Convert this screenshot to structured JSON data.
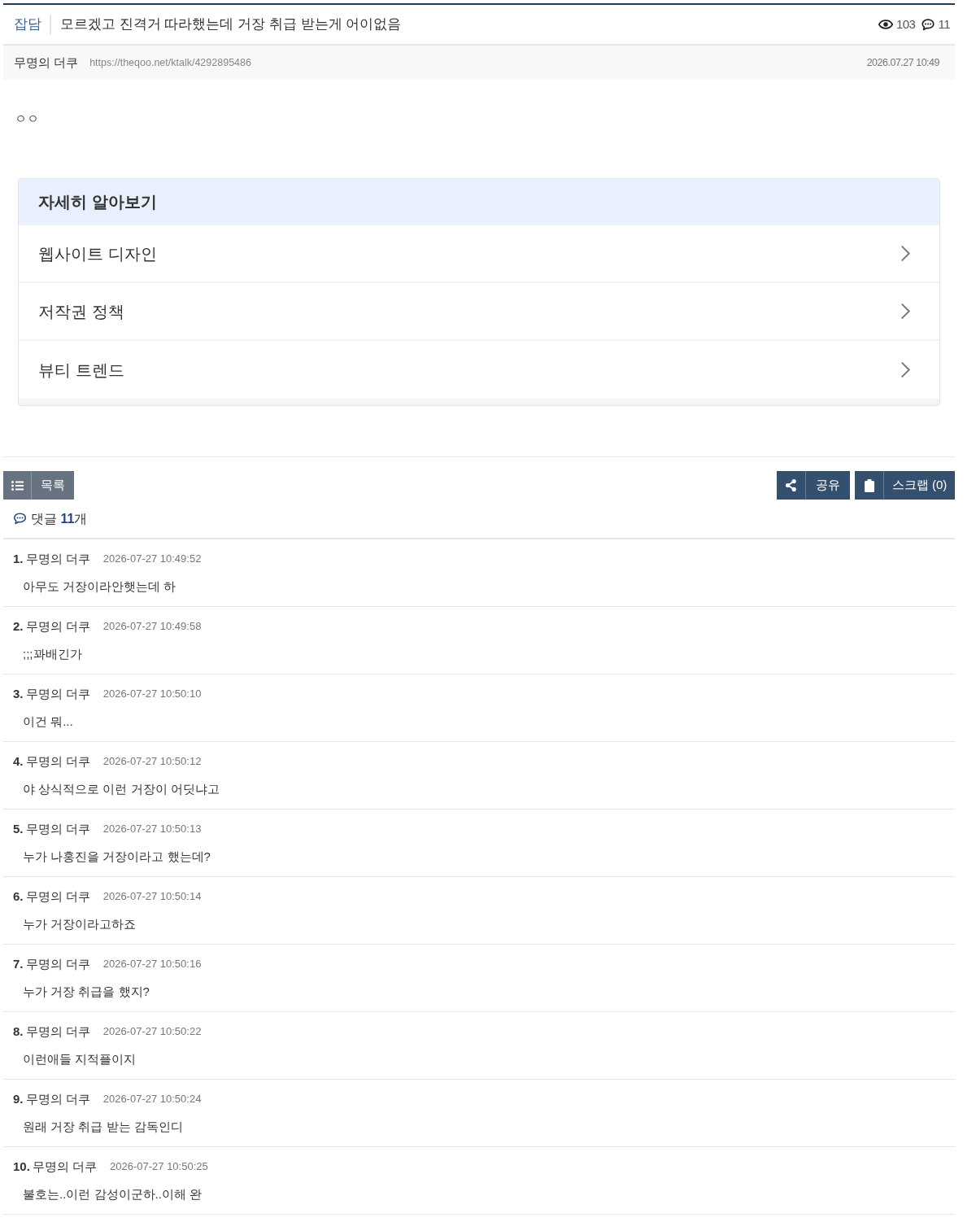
{
  "post": {
    "category": "잡담",
    "title": "모르겠고 진격거 따라했는데 거장 취급 받는게 어이없음",
    "views": "103",
    "comment_count": "11",
    "author": "무명의 더쿠",
    "url": "https://theqoo.net/ktalk/4292895486",
    "date": "2026.07.27 10:49",
    "body": "ㅇㅇ"
  },
  "related": {
    "title": "자세히 알아보기",
    "items": [
      {
        "label": "웹사이트 디자인"
      },
      {
        "label": "저작권 정책"
      },
      {
        "label": "뷰티 트렌드"
      }
    ]
  },
  "actions": {
    "list": "목록",
    "share": "공유",
    "scrap": "스크랩 (0)"
  },
  "comments_heading": "댓글 **11**개",
  "comments": [
    {
      "number": "1.",
      "author": "무명의 더쿠",
      "time": "2026-07-27 10:49:52",
      "text": "아무도 거장이라안햇는데 하"
    },
    {
      "number": "2.",
      "author": "무명의 더쿠",
      "time": "2026-07-27 10:49:58",
      "text": ";;;꽈배긴가"
    },
    {
      "number": "3.",
      "author": "무명의 더쿠",
      "time": "2026-07-27 10:50:10",
      "text": "이건 뭐..."
    },
    {
      "number": "4.",
      "author": "무명의 더쿠",
      "time": "2026-07-27 10:50:12",
      "text": "야 상식적으로 이런 거장이 어딧냐고"
    },
    {
      "number": "5.",
      "author": "무명의 더쿠",
      "time": "2026-07-27 10:50:13",
      "text": "누가 나홍진을 거장이라고 했는데?"
    },
    {
      "number": "6.",
      "author": "무명의 더쿠",
      "time": "2026-07-27 10:50:14",
      "text": "누가 거장이라고하죠"
    },
    {
      "number": "7.",
      "author": "무명의 더쿠",
      "time": "2026-07-27 10:50:16",
      "text": "누가 거장 취급을 했지?"
    },
    {
      "number": "8.",
      "author": "무명의 더쿠",
      "time": "2026-07-27 10:50:22",
      "text": "이런애들 지적플이지"
    },
    {
      "number": "9.",
      "author": "무명의 더쿠",
      "time": "2026-07-27 10:50:24",
      "text": "원래 거장 취급 받는 감독인디"
    },
    {
      "number": "10.",
      "author": "무명의 더쿠",
      "time": "2026-07-27 10:50:25",
      "text": "불호는..이런 감성이군하..이해 완"
    }
  ]
}
